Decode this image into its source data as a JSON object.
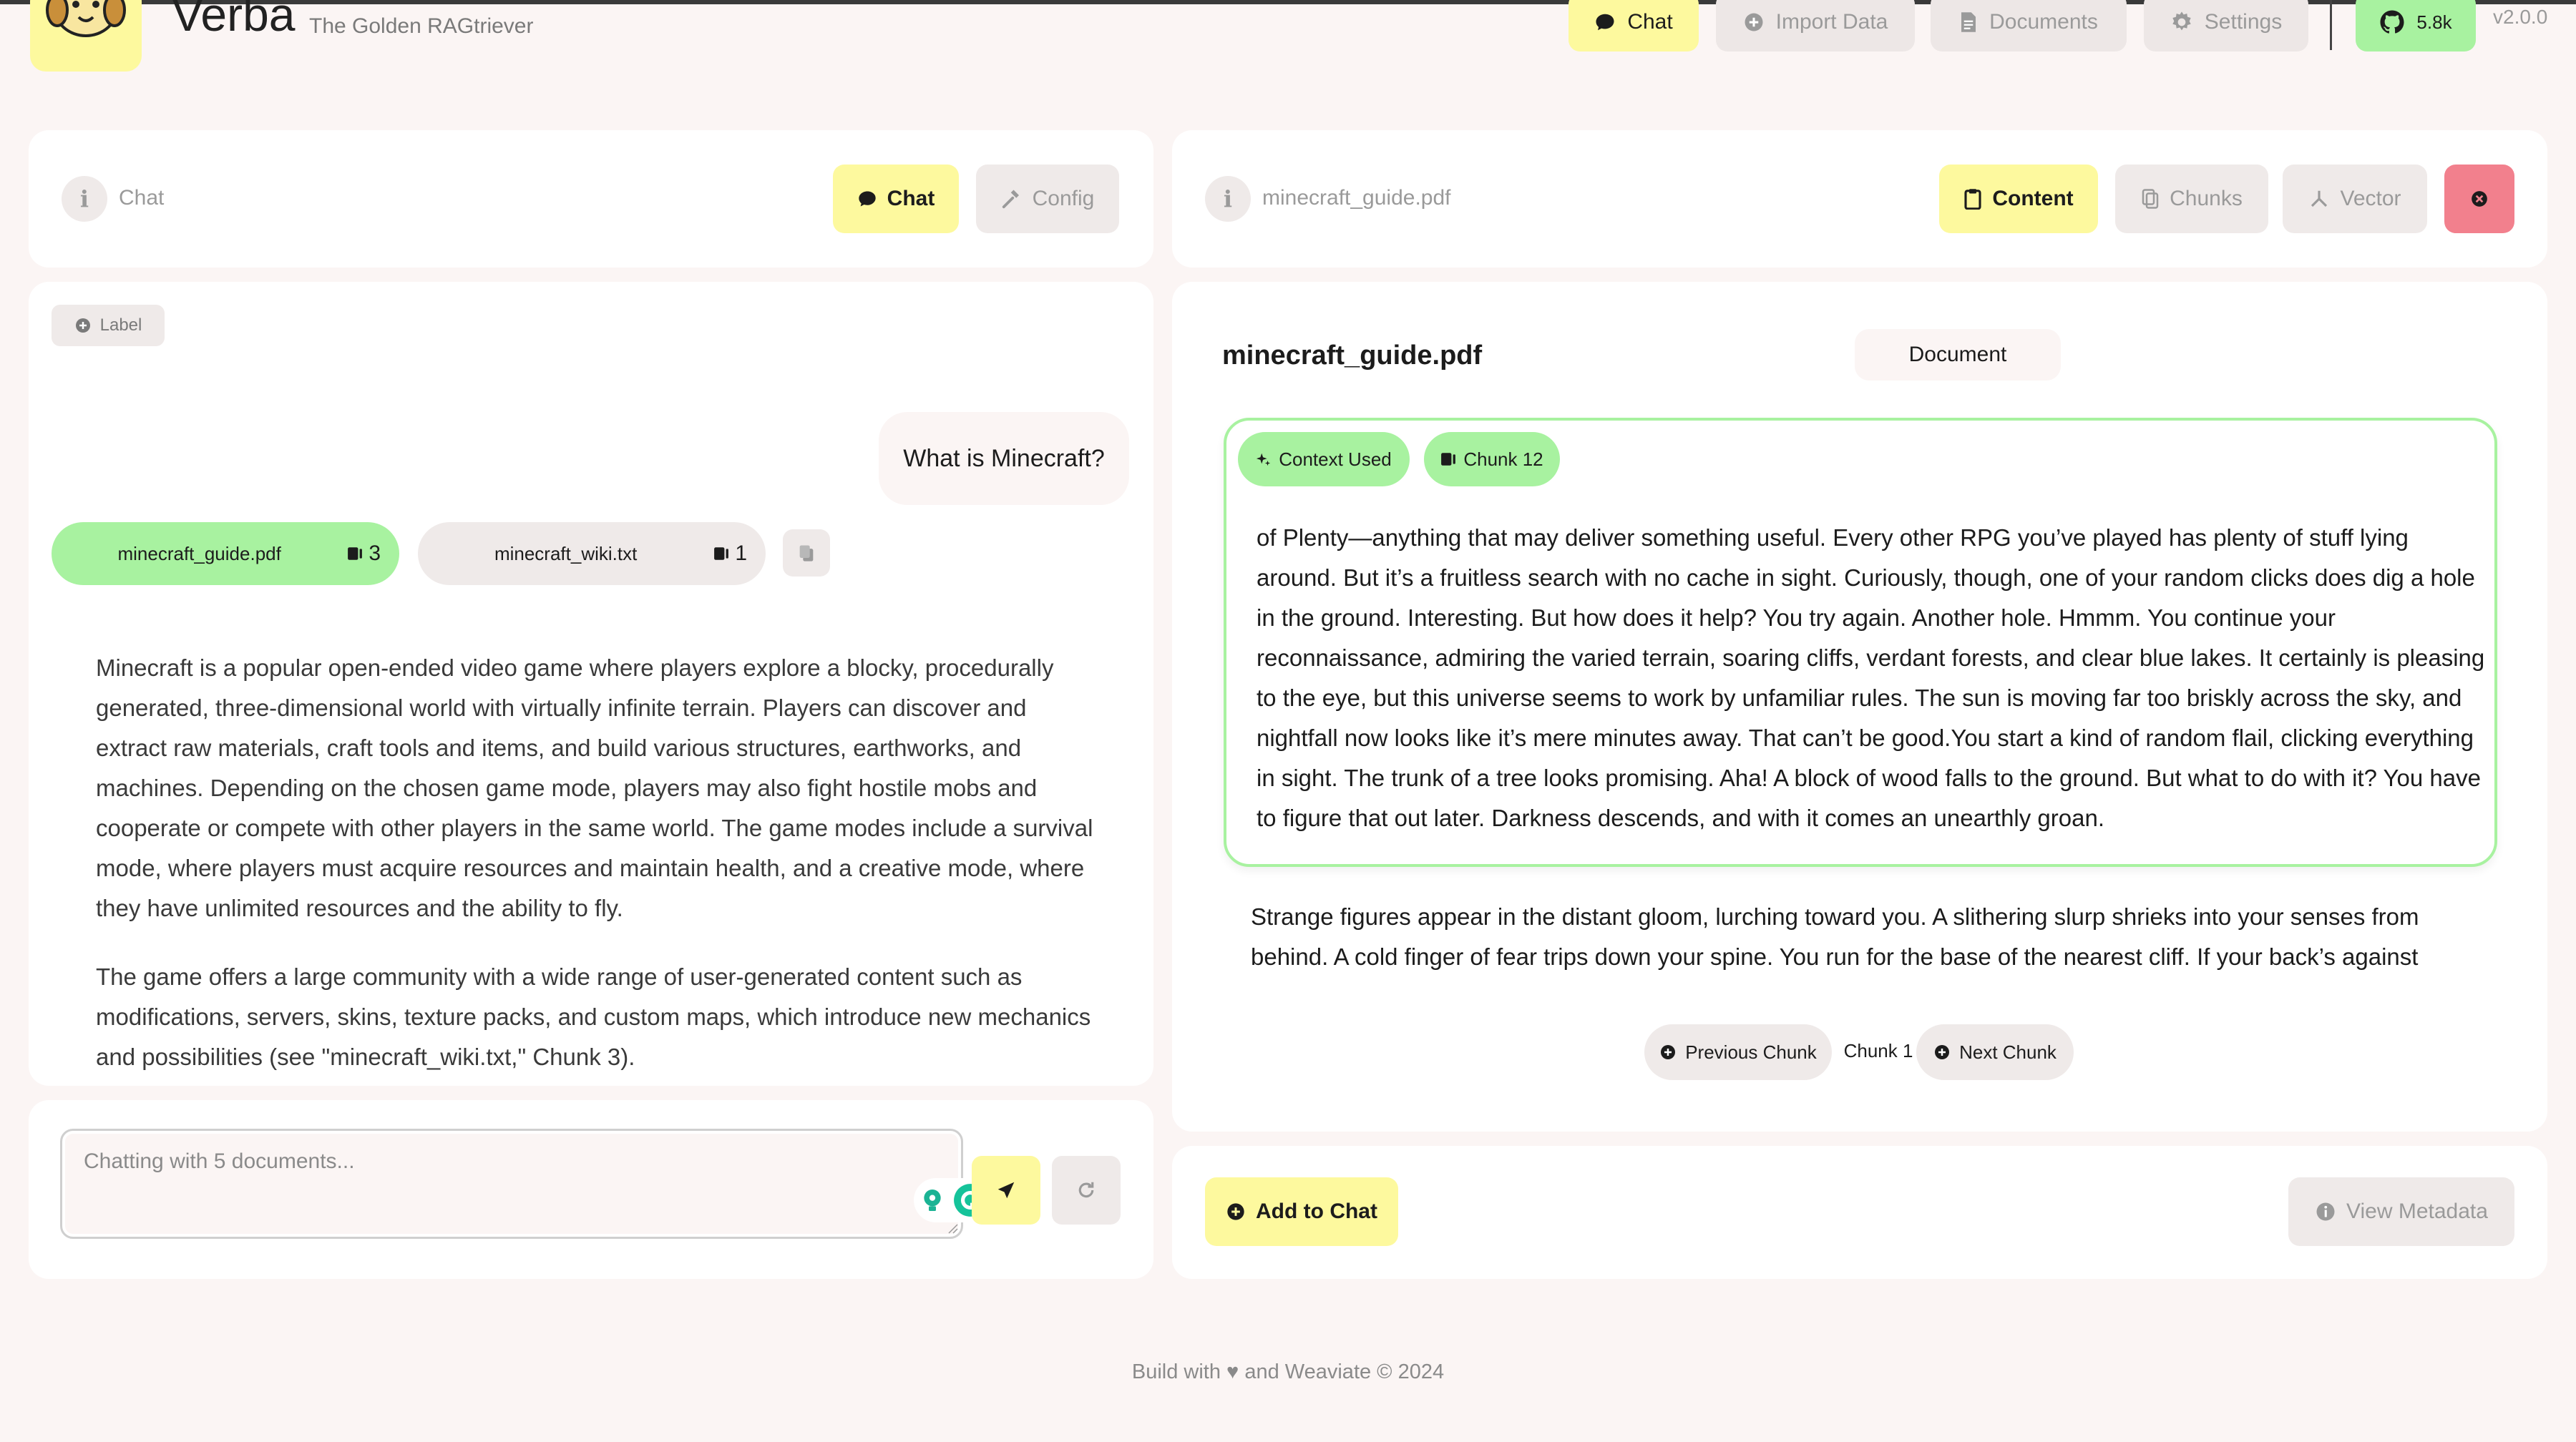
{
  "header": {
    "app_title": "Verba",
    "app_subtitle": "The Golden RAGtriever",
    "nav": [
      {
        "label": "Chat",
        "icon": "chat-bubble-icon",
        "active": true
      },
      {
        "label": "Import Data",
        "icon": "plus-circle-icon",
        "active": false
      },
      {
        "label": "Documents",
        "icon": "document-icon",
        "active": false
      },
      {
        "label": "Settings",
        "icon": "gear-icon",
        "active": false
      }
    ],
    "github_stars": "5.8k",
    "version": "v2.0.0"
  },
  "chat_panel": {
    "title": "Chat",
    "tabs": {
      "chat": "Chat",
      "config": "Config"
    },
    "label_button": "Label",
    "user_message": "What is Minecraft?",
    "sources": [
      {
        "name": "minecraft_guide.pdf",
        "count": "3",
        "selected": true
      },
      {
        "name": "minecraft_wiki.txt",
        "count": "1",
        "selected": false
      }
    ],
    "answer_paragraphs": [
      "Minecraft is a popular open-ended video game where players explore a blocky, procedurally generated, three-dimensional world with virtually infinite terrain. Players can discover and extract raw materials, craft tools and items, and build various structures, earthworks, and machines. Depending on the chosen game mode, players may also fight hostile mobs and cooperate or compete with other players in the same world. The game modes include a survival mode, where players must acquire resources and maintain health, and a creative mode, where they have unlimited resources and the ability to fly.",
      "The game offers a large community with a wide range of user-generated content such as modifications, servers, skins, texture packs, and custom maps, which introduce new mechanics and possibilities (see \"minecraft_wiki.txt,\" Chunk 3)."
    ],
    "input_placeholder": "Chatting with 5 documents..."
  },
  "document_panel": {
    "file_name": "minecraft_guide.pdf",
    "tabs": {
      "content": "Content",
      "chunks": "Chunks",
      "vector": "Vector"
    },
    "doc_title": "minecraft_guide.pdf",
    "doc_tag": "Document",
    "context_chip": "Context Used",
    "chunk_chip": "Chunk 12",
    "chunk_text": "of Plenty—anything that may deliver something useful. Every other RPG you’ve played has plenty of stuff lying around. But it’s a fruitless search with no cache in sight. Curiously, though, one of your random clicks does dig a hole in the ground. Interesting. But how does it help? You try again. Another hole. Hmmm. You continue your reconnaissance, admiring the varied terrain, soaring cliffs, verdant forests, and clear blue lakes. It certainly is pleasing to the eye, but this universe seems to work by unfamiliar rules. The sun is moving far too briskly across the sky, and nightfall now looks like it’s mere minutes away. That can’t be good.You start a kind of random flail, clicking everything in sight. The trunk of a tree looks promising. Aha! A block of wood falls to the ground. But what to do with it? You have to figure that out later. Darkness descends, and with it comes an unearthly groan.",
    "following_text": "Strange figures appear in the distant gloom, lurching toward you. A slithering slurp shrieks into your senses from behind. A cold finger of fear trips down your spine. You run for the base of the nearest cliff. If your back’s against",
    "prev_chunk": "Previous Chunk",
    "current_chunk": "Chunk 1",
    "next_chunk": "Next Chunk",
    "add_to_chat": "Add to Chat",
    "view_metadata": "View Metadata"
  },
  "footer": "Build with ♥ and Weaviate © 2024",
  "colors": {
    "background": "#FBF5F4",
    "card": "#FFFFFF",
    "accent_yellow": "#FDF99E",
    "accent_green": "#A8F2A0",
    "close_red": "#F2808D",
    "muted_gray": "#EFEAE9"
  }
}
